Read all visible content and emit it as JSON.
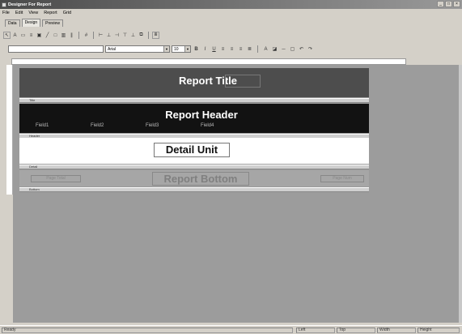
{
  "window": {
    "title": "Designer For Report"
  },
  "menu": [
    "File",
    "Edit",
    "View",
    "Report",
    "Grid"
  ],
  "tabs": [
    "Data",
    "Design",
    "Preview"
  ],
  "toolbar2": {
    "font_name": "Arial",
    "font_size": "10"
  },
  "bands": {
    "title": {
      "label": "Report Title",
      "bar": "Title"
    },
    "header": {
      "label": "Report Header",
      "bar": "Header",
      "fields": [
        "Field1",
        "Field2",
        "Field3",
        "Field4"
      ]
    },
    "detail": {
      "label": "Detail Unit",
      "bar": "Detail"
    },
    "bottom": {
      "label": "Report Bottom",
      "bar": "Bottom",
      "left_box": "Page Total",
      "right_box": "Page Num"
    }
  },
  "status": {
    "left": "Ready",
    "p1": "Left",
    "p2": "Top",
    "p3": "Width",
    "p4": "Height"
  }
}
